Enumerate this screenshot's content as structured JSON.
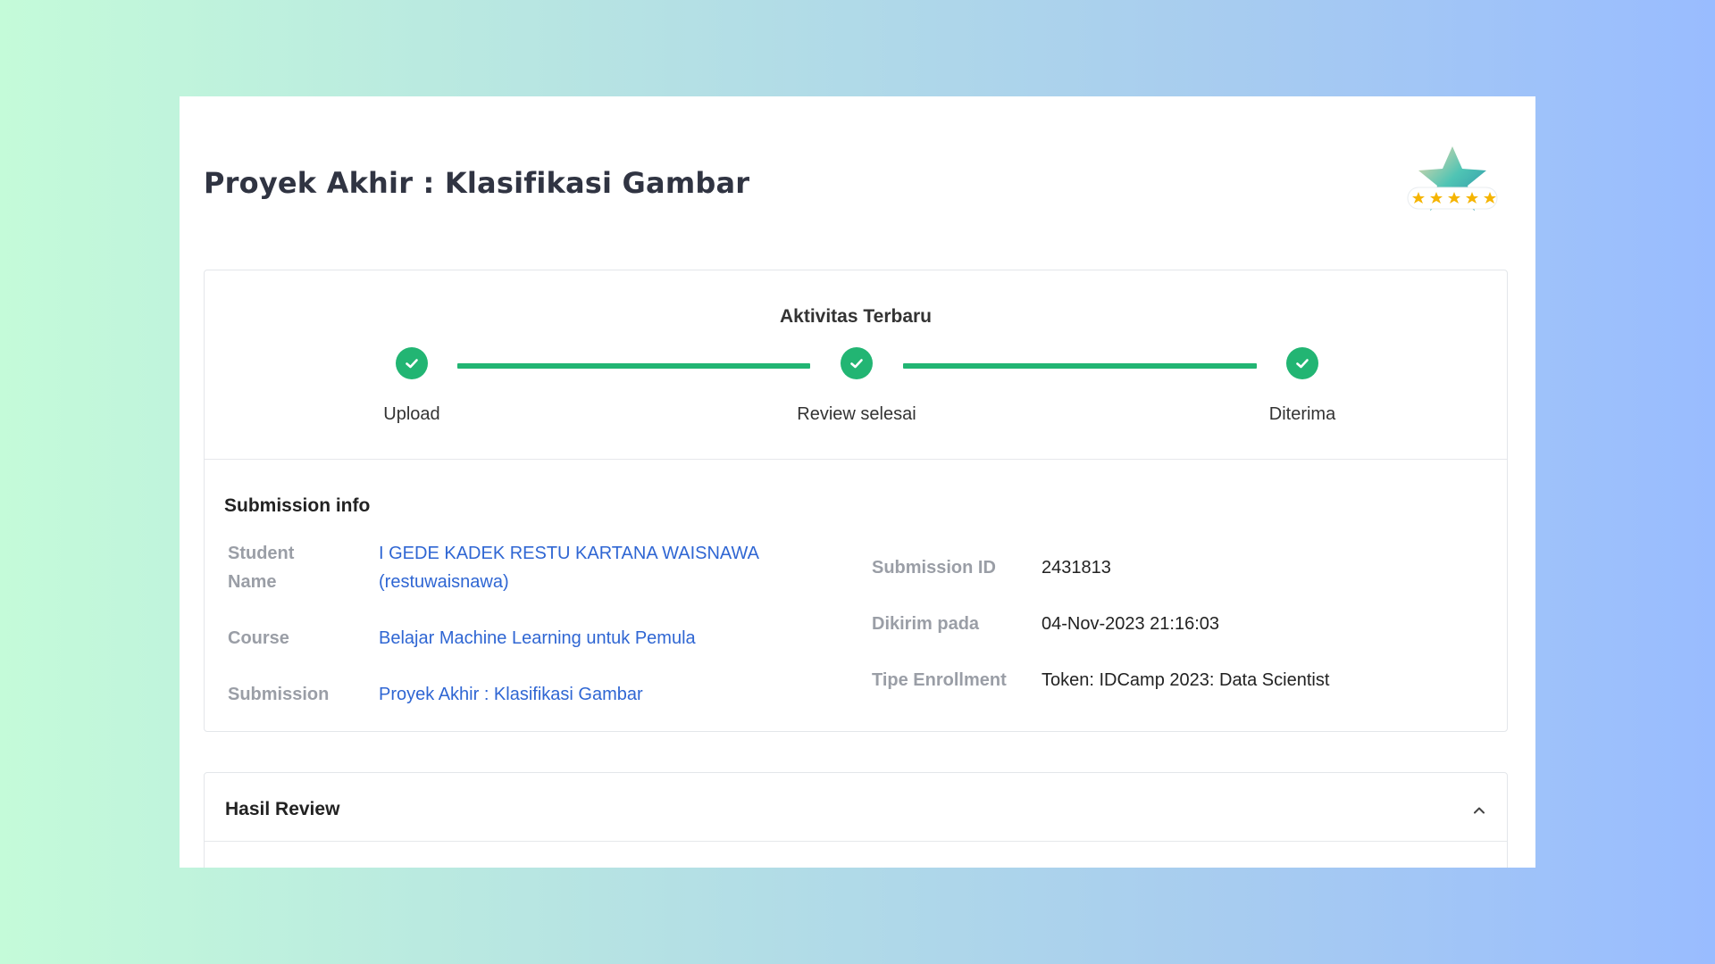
{
  "page": {
    "title": "Proyek Akhir : Klasifikasi Gambar",
    "badge_icon": "five-star-rating-badge-icon"
  },
  "activity": {
    "title": "Aktivitas Terbaru",
    "step_color": "#22b573",
    "steps": [
      {
        "label": "Upload",
        "icon": "check-icon",
        "done": true
      },
      {
        "label": "Review selesai",
        "icon": "check-icon",
        "done": true
      },
      {
        "label": "Diterima",
        "icon": "check-icon",
        "done": true
      }
    ]
  },
  "submission_info": {
    "title": "Submission info",
    "student_name": {
      "label_line1": "Student",
      "label_line2": "Name",
      "value_line1": "I GEDE KADEK RESTU KARTANA WAISNAWA",
      "value_line2": "(restuwaisnawa)"
    },
    "course": {
      "label": "Course",
      "value": "Belajar Machine Learning untuk Pemula"
    },
    "submission": {
      "label": "Submission",
      "value": "Proyek Akhir : Klasifikasi Gambar"
    },
    "submission_id": {
      "label": "Submission ID",
      "value": "2431813"
    },
    "sent_at": {
      "label": "Dikirim pada",
      "value": "04-Nov-2023 21:16:03"
    },
    "enrollment_type": {
      "label": "Tipe Enrollment",
      "value": "Token: IDCamp 2023: Data Scientist"
    }
  },
  "review": {
    "title": "Hasil Review",
    "toggle_icon": "chevron-up-icon"
  },
  "colors": {
    "accent_green": "#22b573",
    "link_blue": "#2f66d3",
    "label_gray": "#9a9ea6"
  }
}
